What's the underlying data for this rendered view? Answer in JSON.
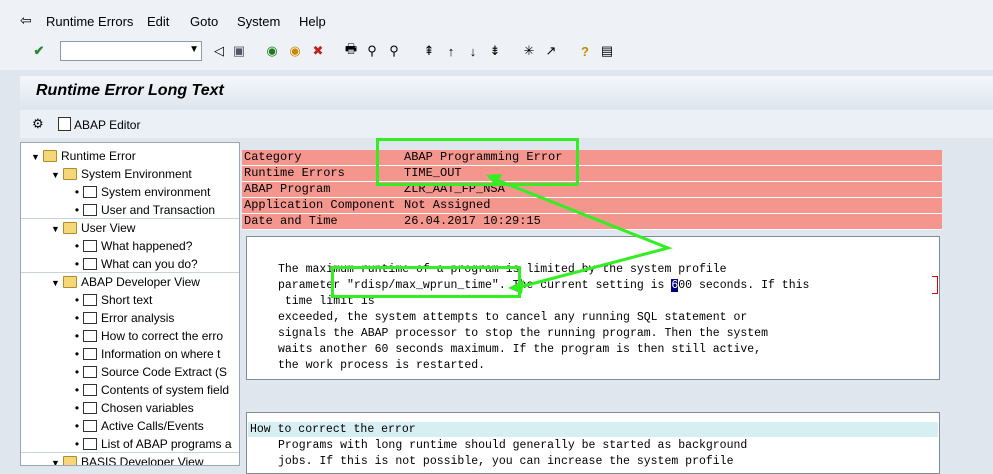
{
  "menu": [
    {
      "label": "Runtime Errors"
    },
    {
      "label": "Edit"
    },
    {
      "label": "Goto"
    },
    {
      "label": "System"
    },
    {
      "label": "Help"
    }
  ],
  "title": "Runtime Error Long Text",
  "app_toolbar": {
    "abap_editor": "ABAP Editor"
  },
  "tree": [
    {
      "label": "Runtime Error",
      "level": 0,
      "type": "folder"
    },
    {
      "label": "System Environment",
      "level": 1,
      "type": "folder"
    },
    {
      "label": "System environment",
      "level": 2,
      "type": "doc"
    },
    {
      "label": "User and Transaction",
      "level": 2,
      "type": "doc"
    },
    {
      "label": "User View",
      "level": 1,
      "type": "folder"
    },
    {
      "label": "What happened?",
      "level": 2,
      "type": "doc"
    },
    {
      "label": "What can you do?",
      "level": 2,
      "type": "doc"
    },
    {
      "label": "ABAP Developer View",
      "level": 1,
      "type": "folder"
    },
    {
      "label": "Short text",
      "level": 2,
      "type": "doc"
    },
    {
      "label": "Error analysis",
      "level": 2,
      "type": "doc"
    },
    {
      "label": "How to correct the erro",
      "level": 2,
      "type": "doc"
    },
    {
      "label": "Information on where t",
      "level": 2,
      "type": "doc"
    },
    {
      "label": "Source Code Extract (S",
      "level": 2,
      "type": "doc"
    },
    {
      "label": "Contents of system field",
      "level": 2,
      "type": "doc"
    },
    {
      "label": "Chosen variables",
      "level": 2,
      "type": "doc"
    },
    {
      "label": "Active Calls/Events",
      "level": 2,
      "type": "doc"
    },
    {
      "label": "List of ABAP programs a",
      "level": 2,
      "type": "doc"
    },
    {
      "label": "BASIS Developer View",
      "level": 1,
      "type": "folder"
    }
  ],
  "header": [
    {
      "key": "Category",
      "value": "ABAP Programming Error"
    },
    {
      "key": "Runtime Errors",
      "value": "TIME_OUT"
    },
    {
      "key": "ABAP Program",
      "value": "ZLR_AAT_FP_NSA"
    },
    {
      "key": "Application Component",
      "value": "Not Assigned"
    },
    {
      "key": "Date and Time",
      "value": "26.04.2017 10:29:15"
    }
  ],
  "body": {
    "line1": "The maximum runtime of a program is limited by the system profile",
    "line2_a": "parameter \"rdisp/max_wprun_time\". The current setting is ",
    "line2_cursor": "6",
    "line2_b": "00 seconds. If this",
    "line3": " time limit is",
    "line4": "exceeded, the system attempts to cancel any running SQL statement or",
    "line5": "signals the ABAP processor to stop the running program. Then the system",
    "line6": "waits another 60 seconds maximum. If the program is then still active,",
    "line7": "the work process is restarted."
  },
  "correct": {
    "heading": "How to correct the error",
    "line1": "Programs with long runtime should generally be started as background",
    "line2": "jobs. If this is not possible, you can increase the system profile"
  }
}
